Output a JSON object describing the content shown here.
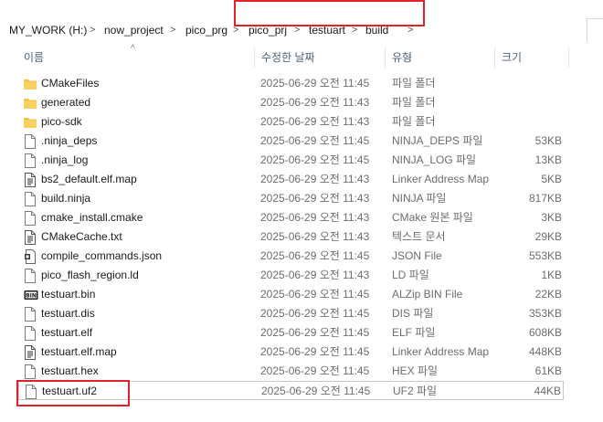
{
  "breadcrumb": {
    "items": [
      "MY_WORK (H:)",
      "now_project",
      "pico_prg",
      "pico_prj",
      "testuart",
      "build"
    ]
  },
  "columns": {
    "name": "이름",
    "modified": "수정한 날짜",
    "type": "유형",
    "size": "크기"
  },
  "files": [
    {
      "name": "CMakeFiles",
      "date": "2025-06-29 오전 11:45",
      "type": "파일 폴더",
      "size": "",
      "icon": "folder-icon"
    },
    {
      "name": "generated",
      "date": "2025-06-29 오전 11:43",
      "type": "파일 폴더",
      "size": "",
      "icon": "folder-icon"
    },
    {
      "name": "pico-sdk",
      "date": "2025-06-29 오전 11:43",
      "type": "파일 폴더",
      "size": "",
      "icon": "folder-icon"
    },
    {
      "name": ".ninja_deps",
      "date": "2025-06-29 오전 11:45",
      "type": "NINJA_DEPS 파일",
      "size": "53KB",
      "icon": "file-icon"
    },
    {
      "name": ".ninja_log",
      "date": "2025-06-29 오전 11:45",
      "type": "NINJA_LOG 파일",
      "size": "13KB",
      "icon": "file-icon"
    },
    {
      "name": "bs2_default.elf.map",
      "date": "2025-06-29 오전 11:43",
      "type": "Linker Address Map",
      "size": "5KB",
      "icon": "text-file-icon"
    },
    {
      "name": "build.ninja",
      "date": "2025-06-29 오전 11:43",
      "type": "NINJA 파일",
      "size": "817KB",
      "icon": "file-icon"
    },
    {
      "name": "cmake_install.cmake",
      "date": "2025-06-29 오전 11:43",
      "type": "CMake 원본 파일",
      "size": "3KB",
      "icon": "file-icon"
    },
    {
      "name": "CMakeCache.txt",
      "date": "2025-06-29 오전 11:43",
      "type": "텍스트 문서",
      "size": "29KB",
      "icon": "text-file-icon"
    },
    {
      "name": "compile_commands.json",
      "date": "2025-06-29 오전 11:45",
      "type": "JSON File",
      "size": "553KB",
      "icon": "json-file-icon"
    },
    {
      "name": "pico_flash_region.ld",
      "date": "2025-06-29 오전 11:43",
      "type": "LD 파일",
      "size": "1KB",
      "icon": "file-icon"
    },
    {
      "name": "testuart.bin",
      "date": "2025-06-29 오전 11:45",
      "type": "ALZip BIN File",
      "size": "22KB",
      "icon": "bin-file-icon"
    },
    {
      "name": "testuart.dis",
      "date": "2025-06-29 오전 11:45",
      "type": "DIS 파일",
      "size": "353KB",
      "icon": "file-icon"
    },
    {
      "name": "testuart.elf",
      "date": "2025-06-29 오전 11:45",
      "type": "ELF 파일",
      "size": "608KB",
      "icon": "file-icon"
    },
    {
      "name": "testuart.elf.map",
      "date": "2025-06-29 오전 11:45",
      "type": "Linker Address Map",
      "size": "448KB",
      "icon": "text-file-icon"
    },
    {
      "name": "testuart.hex",
      "date": "2025-06-29 오전 11:45",
      "type": "HEX 파일",
      "size": "61KB",
      "icon": "file-icon"
    },
    {
      "name": "testuart.uf2",
      "date": "2025-06-29 오전 11:45",
      "type": "UF2 파일",
      "size": "44KB",
      "icon": "file-icon",
      "selected": true
    }
  ],
  "colors": {
    "highlight": "#e0232b",
    "folder": "#f3c344",
    "header_text": "#4c607a"
  }
}
